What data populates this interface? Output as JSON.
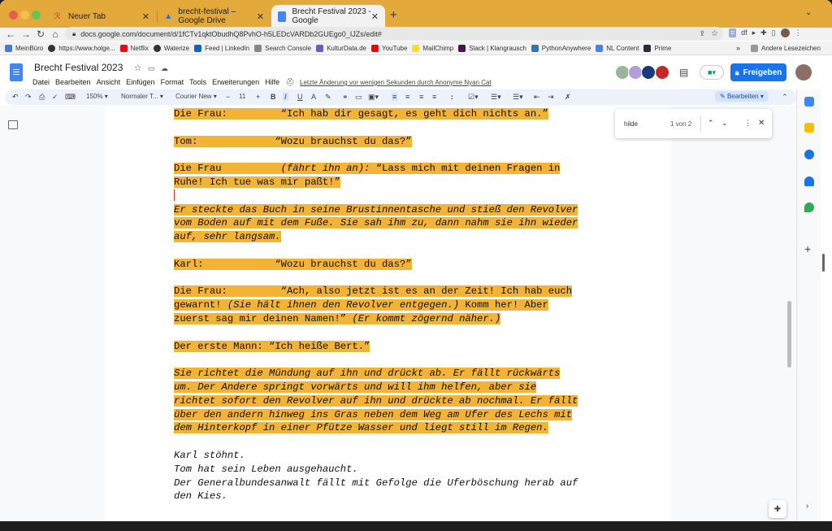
{
  "browser": {
    "tabs": [
      {
        "label": "Neuer Tab"
      },
      {
        "label": "brecht-festival – Google Drive"
      },
      {
        "label": "Brecht Festival 2023 - Google"
      }
    ],
    "url": "docs.google.com/document/d/1fCTv1qktObudhQ8PvhO-h5LEDcVARDb2GUEgo0_IJZs/edit#",
    "bookmarks": [
      "MeinBüro",
      "https://www.holge...",
      "Netflix",
      "Waterize",
      "Feed | LinkedIn",
      "Search Console",
      "KulturData.de",
      "YouTube",
      "MailChimp",
      "Slack | Klangrausch",
      "PythonAnywhere",
      "NL Content",
      "Prime"
    ],
    "other_bookmarks": "Andere Lesezeichen"
  },
  "docs": {
    "title": "Brecht Festival 2023",
    "menu": [
      "Datei",
      "Bearbeiten",
      "Ansicht",
      "Einfügen",
      "Format",
      "Tools",
      "Erweiterungen",
      "Hilfe"
    ],
    "last_edit": "Letzte Änderung vor wenigen Sekunden durch Anonyme Nyan Cat",
    "share_label": "Freigeben",
    "toolbar": {
      "zoom": "150%",
      "style": "Normaler T...",
      "font": "Courier New",
      "font_size": "11",
      "mode": "Bearbeiten"
    },
    "find": {
      "query": "hilde",
      "count": "1 von 2"
    }
  },
  "content": {
    "l1_speaker": "Die Frau:",
    "l1_text": "“Ich hab dir gesagt, es geht dich nichts an.”",
    "l2_speaker": "Tom:",
    "l2_text": "“Wozu brauchst du das?”",
    "l3_speaker": "Die Frau",
    "l3_dir": "(fährt ihn an):",
    "l3_text": " “Lass mich mit deinen Fragen in",
    "l3_text2": "Ruhe! Ich tue was mir paßt!”",
    "p4_line1": "Er steckte das Buch in seine Brustinnentasche und stieß den Revolver",
    "p4_line2": "vom Boden auf mit dem Fuße. Sie sah ihm zu, dann nahm sie ihn wieder",
    "p4_line3": "auf, sehr langsam.",
    "l5_speaker": "Karl:",
    "l5_text": "“Wozu brauchst du das?”",
    "l6_speaker": "Die Frau:",
    "l6_text1": "“Ach, also jetzt ist es an der Zeit! Ich hab euch",
    "l6_text2a": "gewarnt! ",
    "l6_dir1": "(Sie hält ihnen den Revolver entgegen.)",
    "l6_text2b": " Komm her! Aber",
    "l6_text3a": "zuerst sag mir deinen Namen!” ",
    "l6_dir2": "(Er kommt zögernd näher.)",
    "l7": "Der erste Mann: “Ich heiße Bert.”",
    "p8_line1": "Sie richtet die Mündung auf ihn und drückt ab. Er fällt rückwärts",
    "p8_line2": "um. Der Andere springt vorwärts und will ihm helfen, aber sie",
    "p8_line3": "richtet sofort den Revolver auf ihn und drückte ab nochmal. Er fällt",
    "p8_line4": "über den andern hinweg ins Gras neben dem Weg am Ufer des Lechs mit",
    "p8_line5": "dem Hinterkopf in einer Pfütze Wasser und liegt still im Regen.",
    "p9_line1": "Karl stöhnt.",
    "p9_line2": "Tom hat sein Leben ausgehaucht.",
    "p9_line3": "Der Generalbundesanwalt fällt mit Gefolge die Uferböschung herab auf",
    "p9_line4": "den Kies."
  },
  "colors": {
    "highlight": "#f3b337",
    "tabstrip": "#e3a93b",
    "share": "#1a73e8"
  }
}
